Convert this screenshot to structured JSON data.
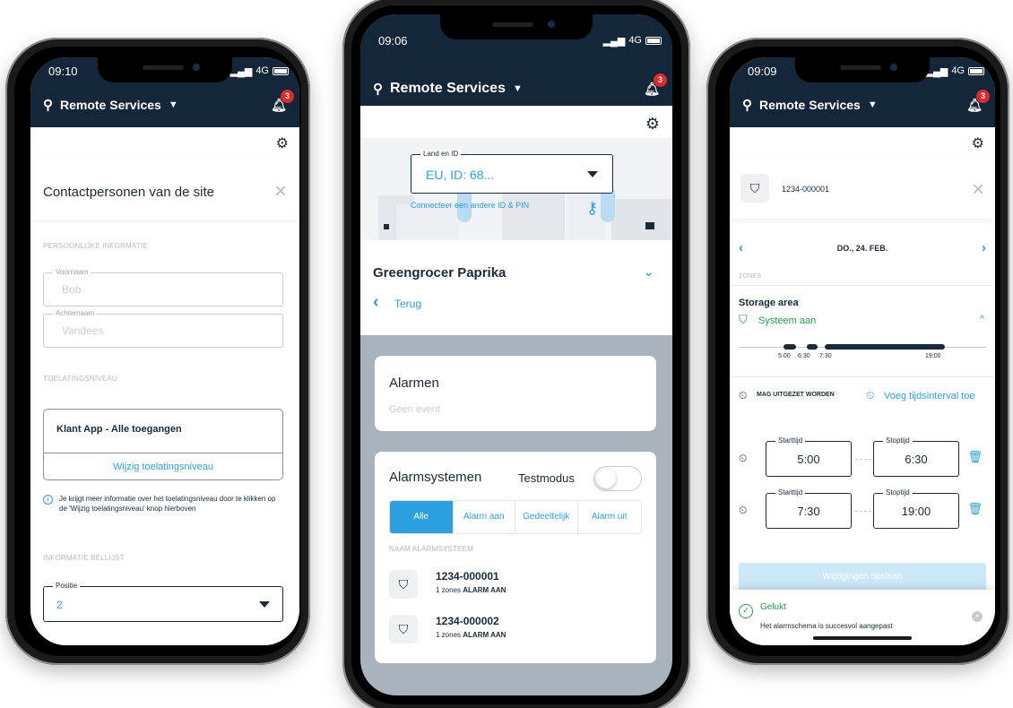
{
  "app": {
    "title": "Remote Services",
    "notif_count": "3"
  },
  "phone_left": {
    "time": "09:10",
    "network": "4G",
    "panel_title": "Contactpersonen van de site",
    "section_personal": "PERSOONLIJKE INFORMATIE",
    "first_name_label": "Voornaam",
    "first_name_value": "Bob",
    "last_name_label": "Achternaam",
    "last_name_value": "Vandees",
    "section_level": "TOELATINGSNIVEAU",
    "level_value": "Klant App - Alle toegangen",
    "level_button": "Wijzig toelatingsniveau",
    "info_text": "Je krijgt meer informatie over het toelatingsniveau door te klikken op de 'Wijzig toelatingsniveau' knop hierboven",
    "section_calllist": "INFORMATIE BELLIJST",
    "position_label": "Positie",
    "position_value": "2"
  },
  "phone_middle": {
    "time": "09:06",
    "network": "4G",
    "country_label": "Land en ID",
    "country_value": "EU, ID: 68...",
    "connect_link": "Connecteer een andere ID & PIN",
    "site_name": "Greengrocer Paprika",
    "back_label": "Terug",
    "alarms_title": "Alarmen",
    "alarms_empty": "Geen event",
    "systems_title": "Alarmsystemen",
    "test_mode_label": "Testmodus",
    "filters": [
      "Alle",
      "Alarm aan",
      "Gedeeltelijk",
      "Alarm uit"
    ],
    "list_header": "NAAM ALARMSYSTEEM",
    "systems": [
      {
        "id": "1234-000001",
        "zones": "1 zones",
        "status": "ALARM AAN"
      },
      {
        "id": "1234-000002",
        "zones": "1 zones",
        "status": "ALARM AAN"
      }
    ]
  },
  "phone_right": {
    "time": "09:09",
    "network": "4G",
    "system_id": "1234-000001",
    "date": "DO., 24. FEB.",
    "zones_label": "ZONES",
    "zone_name": "Storage area",
    "zone_status": "Systeem aan",
    "timeline_labels": [
      "5:00",
      "6:30",
      "7:30",
      "19:00"
    ],
    "may_disarm": "MAG UITGEZET WORDEN",
    "add_interval": "Voeg tijdsinterval toe",
    "start_label": "Starttijd",
    "stop_label": "Stoptijd",
    "intervals": [
      {
        "start": "5:00",
        "stop": "6:30"
      },
      {
        "start": "7:30",
        "stop": "19:00"
      }
    ],
    "save_button": "Wijzigingen opslaan",
    "toast_title": "Gelukt",
    "toast_message": "Het alarmschema is succesvol aangepast"
  }
}
